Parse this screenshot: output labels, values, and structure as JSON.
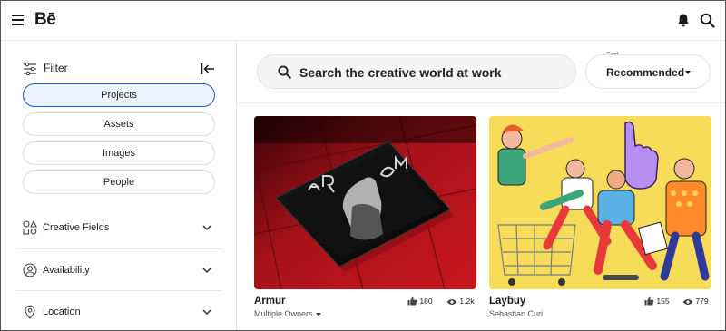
{
  "header": {
    "logo": "Bē",
    "menu_icon": "hamburger-icon",
    "notifications_icon": "bell-icon",
    "search_icon": "search-icon"
  },
  "sidebar": {
    "filter_label": "Filter",
    "tabs": [
      {
        "label": "Projects",
        "active": true
      },
      {
        "label": "Assets",
        "active": false
      },
      {
        "label": "Images",
        "active": false
      },
      {
        "label": "People",
        "active": false
      }
    ],
    "sections": [
      {
        "label": "Creative Fields",
        "icon": "shapes-icon"
      },
      {
        "label": "Availability",
        "icon": "person-circle-icon"
      },
      {
        "label": "Location",
        "icon": "map-pin-icon"
      }
    ]
  },
  "search": {
    "placeholder": "Search the creative world at work"
  },
  "sort": {
    "label": "Sort",
    "value": "Recommended"
  },
  "projects": [
    {
      "title": "Armur",
      "owner": "Multiple Owners",
      "likes": "180",
      "views": "1.2k"
    },
    {
      "title": "Laybuy",
      "owner": "Sebastian Curi",
      "likes": "155",
      "views": "779"
    }
  ],
  "colors": {
    "accent": "#1d5bd6",
    "armur_red": "#c0141c",
    "laybuy_yellow": "#f7dc5a"
  }
}
